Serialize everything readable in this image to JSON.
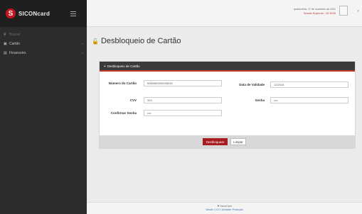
{
  "sidebar": {
    "logo_text": "SICONcard",
    "items": [
      {
        "label": "Buscar",
        "icon": "search-icon"
      },
      {
        "label": "Cartão",
        "icon": "card-icon"
      },
      {
        "label": "Financeiro",
        "icon": "bar-chart-icon"
      }
    ]
  },
  "header": {
    "date_line": "quarta-feira, 17 de novembro de 2021",
    "session_line": "Sessão Expira em : 00:19:59"
  },
  "page": {
    "title": "Desbloqueio de Cartão"
  },
  "form": {
    "panel_title": "Desbloqueio de Cartão",
    "card_number_label": "Número do Cartão",
    "card_number_value": "6060080000045018",
    "expiry_label": "Data de Validade",
    "expiry_value": "12/2024",
    "cvv_label": "CVV",
    "cvv_value": "324",
    "password_label": "Senha",
    "password_value": "••••",
    "confirm_label": "Confirmar Senha",
    "confirm_value": "••••",
    "submit_label": "Desbloquear",
    "clear_label": "Limpar"
  },
  "footer": {
    "brand": "SiconCard",
    "version_line": "Versão 1.0.0 | Unidade: Produção"
  },
  "colors": {
    "sidebar": "#2c2c2c",
    "accent": "#a61c20",
    "panel_header": "#3a3a3a"
  }
}
